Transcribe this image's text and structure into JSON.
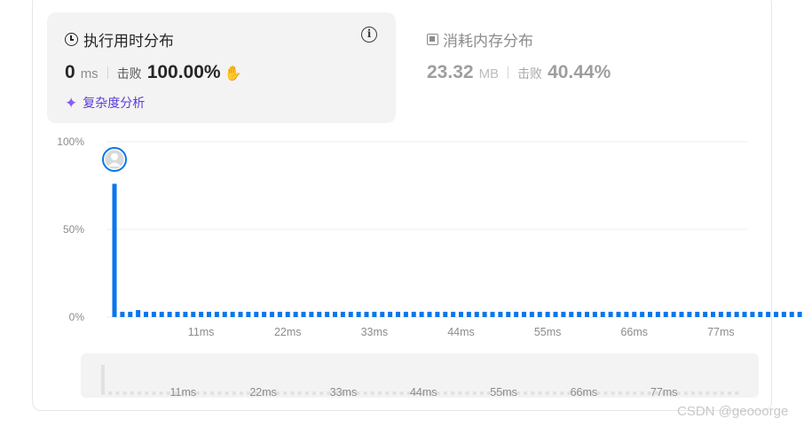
{
  "runtime": {
    "title": "执行用时分布",
    "value": "0",
    "unit": "ms",
    "beat_label": "击败",
    "beat_percent": "100.00%",
    "analysis_link": "复杂度分析"
  },
  "memory": {
    "title": "消耗内存分布",
    "value": "23.32",
    "unit": "MB",
    "beat_label": "击败",
    "beat_percent": "40.44%"
  },
  "icons": {
    "runtime": "clock-icon",
    "info": "info-icon",
    "celebrate": "waving-hands-icon",
    "analysis": "sparkle-icon",
    "memory": "chip-icon",
    "user": "user-avatar"
  },
  "colors": {
    "bar": "#0a76ec",
    "accent_purple": "#5c3bd6",
    "beat_icon": "#2db55d",
    "nav_bar": "#e2e2e2"
  },
  "watermark": "CSDN @geooorge",
  "chart_data": {
    "type": "bar",
    "y_ticks": [
      "100%",
      "50%",
      "0%"
    ],
    "ylim": [
      0,
      100
    ],
    "x_ticks": [
      "11ms",
      "22ms",
      "33ms",
      "44ms",
      "55ms",
      "66ms",
      "77ms"
    ],
    "x_tick_values": [
      11,
      22,
      33,
      44,
      55,
      66,
      77
    ],
    "x_values": [
      0,
      1,
      2,
      3,
      4,
      5,
      6,
      7,
      8,
      9,
      10,
      11,
      12,
      13,
      14,
      15,
      16,
      17,
      18,
      19,
      20,
      21,
      22,
      23,
      24,
      25,
      26,
      27,
      28,
      29,
      30,
      31,
      32,
      33,
      34,
      35,
      36,
      37,
      38,
      39,
      40,
      41,
      42,
      43,
      44,
      45,
      46,
      47,
      48,
      49,
      50,
      51,
      52,
      53,
      54,
      55,
      56,
      57,
      58,
      59,
      60,
      61,
      62,
      63,
      64,
      65,
      66,
      67,
      68,
      69,
      70,
      71,
      72,
      73,
      74,
      75,
      76,
      77,
      78,
      79,
      80,
      81,
      82,
      83,
      84,
      85,
      86,
      87
    ],
    "values": [
      76,
      3,
      3,
      4,
      3,
      3,
      3,
      3,
      3,
      3,
      3,
      3,
      3,
      3,
      3,
      3,
      3,
      3,
      3,
      3,
      3,
      3,
      3,
      3,
      3,
      3,
      3,
      3,
      3,
      3,
      3,
      3,
      3,
      3,
      3,
      3,
      3,
      3,
      3,
      3,
      3,
      3,
      3,
      3,
      3,
      3,
      3,
      3,
      3,
      3,
      3,
      3,
      3,
      3,
      3,
      3,
      3,
      3,
      3,
      3,
      3,
      3,
      3,
      3,
      3,
      3,
      3,
      3,
      3,
      3,
      3,
      3,
      3,
      3,
      3,
      3,
      3,
      3,
      3,
      3,
      3,
      3,
      3,
      3,
      3,
      3,
      3,
      3
    ],
    "highlight_index": 0,
    "grid": true
  },
  "navigator": {
    "x_ticks": [
      "11ms",
      "22ms",
      "33ms",
      "44ms",
      "55ms",
      "66ms",
      "77ms"
    ]
  }
}
